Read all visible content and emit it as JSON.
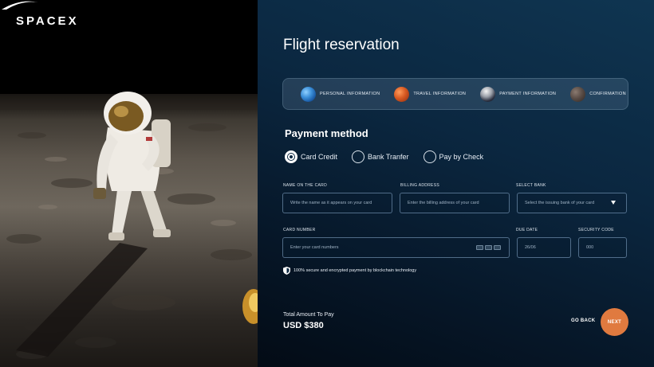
{
  "brand": {
    "logo_text": "SPACEX"
  },
  "header": {
    "title": "Flight reservation"
  },
  "steps": [
    {
      "label": "PERSONAL INFORMATION",
      "icon": "earth-icon"
    },
    {
      "label": "TRAVEL INFORMATION",
      "icon": "mars-icon"
    },
    {
      "label": "PAYMENT INFORMATION",
      "icon": "moon-icon"
    },
    {
      "label": "CONFIRMATION",
      "icon": "asteroid-icon"
    }
  ],
  "payment": {
    "section_title": "Payment method",
    "options": [
      {
        "label": "Card Credit",
        "selected": true
      },
      {
        "label": "Bank Tranfer",
        "selected": false
      },
      {
        "label": "Pay by Check",
        "selected": false
      }
    ]
  },
  "fields": {
    "name_label": "NAME ON THE CARD",
    "name_placeholder": "Write the name as it appears on your card",
    "billing_label": "BILLING ADDRESS",
    "billing_placeholder": "Enter the billing address of your card",
    "bank_label": "SELECT BANK",
    "bank_placeholder": "Select the issuing bank of your card",
    "card_label": "CARD NUMBER",
    "card_placeholder": "Enter your card numbers",
    "due_label": "DUE DATE",
    "due_placeholder": "26/06",
    "security_label": "SECURITY CODE",
    "security_placeholder": "000"
  },
  "secure_note": "100% secure and encrypted payment by blockchain technology",
  "footer": {
    "total_label": "Total Amount To Pay",
    "total_value": "USD $380",
    "back_label": "GO BACK",
    "next_label": "NEXT"
  },
  "colors": {
    "accent": "#e07a3f",
    "panel_top": "#0f3551",
    "panel_bottom": "#030b15"
  }
}
